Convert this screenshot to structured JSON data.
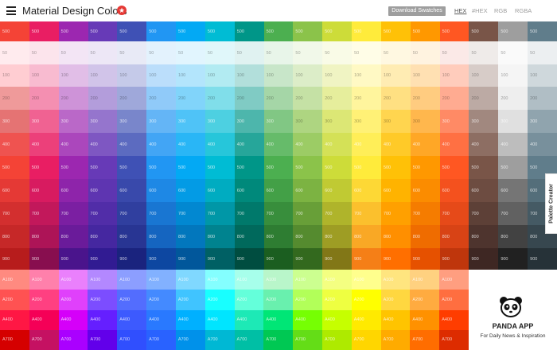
{
  "header": {
    "title": "Material Design Colors",
    "badge_icon": "star",
    "download_label": "Download Swatches",
    "formats": [
      "HEX",
      "#HEX",
      "RGB",
      "RGBA"
    ],
    "active_format": "HEX"
  },
  "palette_tab_label": "Palette Creator",
  "shade_labels": [
    "500",
    "50",
    "100",
    "200",
    "300",
    "400",
    "500",
    "600",
    "700",
    "800",
    "900"
  ],
  "accent_labels": [
    "A100",
    "A200",
    "A400",
    "A700"
  ],
  "colors": [
    [
      "#F44336",
      "#FFEBEE",
      "#FFCDD2",
      "#EF9A9A",
      "#E57373",
      "#EF5350",
      "#F44336",
      "#E53935",
      "#D32F2F",
      "#C62828",
      "#B71C1C"
    ],
    [
      "#E91E63",
      "#FCE4EC",
      "#F8BBD0",
      "#F48FB1",
      "#F06292",
      "#EC407A",
      "#E91E63",
      "#D81B60",
      "#C2185B",
      "#AD1457",
      "#880E4F"
    ],
    [
      "#9C27B0",
      "#F3E5F5",
      "#E1BEE7",
      "#CE93D8",
      "#BA68C8",
      "#AB47BC",
      "#9C27B0",
      "#8E24AA",
      "#7B1FA2",
      "#6A1B9A",
      "#4A148C"
    ],
    [
      "#673AB7",
      "#EDE7F6",
      "#D1C4E9",
      "#B39DDB",
      "#9575CD",
      "#7E57C2",
      "#673AB7",
      "#5E35B1",
      "#512DA8",
      "#4527A0",
      "#311B92"
    ],
    [
      "#3F51B5",
      "#E8EAF6",
      "#C5CAE9",
      "#9FA8DA",
      "#7986CB",
      "#5C6BC0",
      "#3F51B5",
      "#3949AB",
      "#303F9F",
      "#283593",
      "#1A237E"
    ],
    [
      "#2196F3",
      "#E3F2FD",
      "#BBDEFB",
      "#90CAF9",
      "#64B5F6",
      "#42A5F5",
      "#2196F3",
      "#1E88E5",
      "#1976D2",
      "#1565C0",
      "#0D47A1"
    ],
    [
      "#03A9F4",
      "#E1F5FE",
      "#B3E5FC",
      "#81D4FA",
      "#4FC3F7",
      "#29B6F6",
      "#03A9F4",
      "#039BE5",
      "#0288D1",
      "#0277BD",
      "#01579B"
    ],
    [
      "#00BCD4",
      "#E0F7FA",
      "#B2EBF2",
      "#80DEEA",
      "#4DD0E1",
      "#26C6DA",
      "#00BCD4",
      "#00ACC1",
      "#0097A7",
      "#00838F",
      "#006064"
    ],
    [
      "#009688",
      "#E0F2F1",
      "#B2DFDB",
      "#80CBC4",
      "#4DB6AC",
      "#26A69A",
      "#009688",
      "#00897B",
      "#00796B",
      "#00695C",
      "#004D40"
    ],
    [
      "#4CAF50",
      "#E8F5E9",
      "#C8E6C9",
      "#A5D6A7",
      "#81C784",
      "#66BB6A",
      "#4CAF50",
      "#43A047",
      "#388E3C",
      "#2E7D32",
      "#1B5E20"
    ],
    [
      "#8BC34A",
      "#F1F8E9",
      "#DCEDC8",
      "#C5E1A5",
      "#AED581",
      "#9CCC65",
      "#8BC34A",
      "#7CB342",
      "#689F38",
      "#558B2F",
      "#33691E"
    ],
    [
      "#CDDC39",
      "#F9FBE7",
      "#F0F4C3",
      "#E6EE9C",
      "#DCE775",
      "#D4E157",
      "#CDDC39",
      "#C0CA33",
      "#AFB42B",
      "#9E9D24",
      "#827717"
    ],
    [
      "#FFEB3B",
      "#FFFDE7",
      "#FFF9C4",
      "#FFF59D",
      "#FFF176",
      "#FFEE58",
      "#FFEB3B",
      "#FDD835",
      "#FBC02D",
      "#F9A825",
      "#F57F17"
    ],
    [
      "#FFC107",
      "#FFF8E1",
      "#FFECB3",
      "#FFE082",
      "#FFD54F",
      "#FFCA28",
      "#FFC107",
      "#FFB300",
      "#FFA000",
      "#FF8F00",
      "#FF6F00"
    ],
    [
      "#FF9800",
      "#FFF3E0",
      "#FFE0B2",
      "#FFCC80",
      "#FFB74D",
      "#FFA726",
      "#FF9800",
      "#FB8C00",
      "#F57C00",
      "#EF6C00",
      "#E65100"
    ],
    [
      "#FF5722",
      "#FBE9E7",
      "#FFCCBC",
      "#FFAB91",
      "#FF8A65",
      "#FF7043",
      "#FF5722",
      "#F4511E",
      "#E64A19",
      "#D84315",
      "#BF360C"
    ],
    [
      "#795548",
      "#EFEBE9",
      "#D7CCC8",
      "#BCAAA4",
      "#A1887F",
      "#8D6E63",
      "#795548",
      "#6D4C41",
      "#5D4037",
      "#4E342E",
      "#3E2723"
    ],
    [
      "#9E9E9E",
      "#FAFAFA",
      "#F5F5F5",
      "#EEEEEE",
      "#E0E0E0",
      "#BDBDBD",
      "#9E9E9E",
      "#757575",
      "#616161",
      "#424242",
      "#212121"
    ],
    [
      "#607D8B",
      "#ECEFF1",
      "#CFD8DC",
      "#B0BEC5",
      "#90A4AE",
      "#78909C",
      "#607D8B",
      "#546E7A",
      "#455A64",
      "#37474F",
      "#263238"
    ]
  ],
  "accents": [
    [
      "#FF8A80",
      "#FF5252",
      "#FF1744",
      "#D50000"
    ],
    [
      "#FF80AB",
      "#FF4081",
      "#F50057",
      "#C51162"
    ],
    [
      "#EA80FC",
      "#E040FB",
      "#D500F9",
      "#AA00FF"
    ],
    [
      "#B388FF",
      "#7C4DFF",
      "#651FFF",
      "#6200EA"
    ],
    [
      "#8C9EFF",
      "#536DFE",
      "#3D5AFE",
      "#304FFE"
    ],
    [
      "#82B1FF",
      "#448AFF",
      "#2979FF",
      "#2962FF"
    ],
    [
      "#80D8FF",
      "#40C4FF",
      "#00B0FF",
      "#0091EA"
    ],
    [
      "#84FFFF",
      "#18FFFF",
      "#00E5FF",
      "#00B8D4"
    ],
    [
      "#A7FFEB",
      "#64FFDA",
      "#1DE9B6",
      "#00BFA5"
    ],
    [
      "#B9F6CA",
      "#69F0AE",
      "#00E676",
      "#00C853"
    ],
    [
      "#CCFF90",
      "#B2FF59",
      "#76FF03",
      "#64DD17"
    ],
    [
      "#F4FF81",
      "#EEFF41",
      "#C6FF00",
      "#AEEA00"
    ],
    [
      "#FFFF8D",
      "#FFFF00",
      "#FFEA00",
      "#FFD600"
    ],
    [
      "#FFE57F",
      "#FFD740",
      "#FFC400",
      "#FFAB00"
    ],
    [
      "#FFD180",
      "#FFAB40",
      "#FF9100",
      "#FF6D00"
    ],
    [
      "#FF9E80",
      "#FF6E40",
      "#FF3D00",
      "#DD2C00"
    ]
  ],
  "ad": {
    "title": "PANDA APP",
    "subtitle": "For Daily News & Inspiration",
    "icon": "panda-icon"
  }
}
